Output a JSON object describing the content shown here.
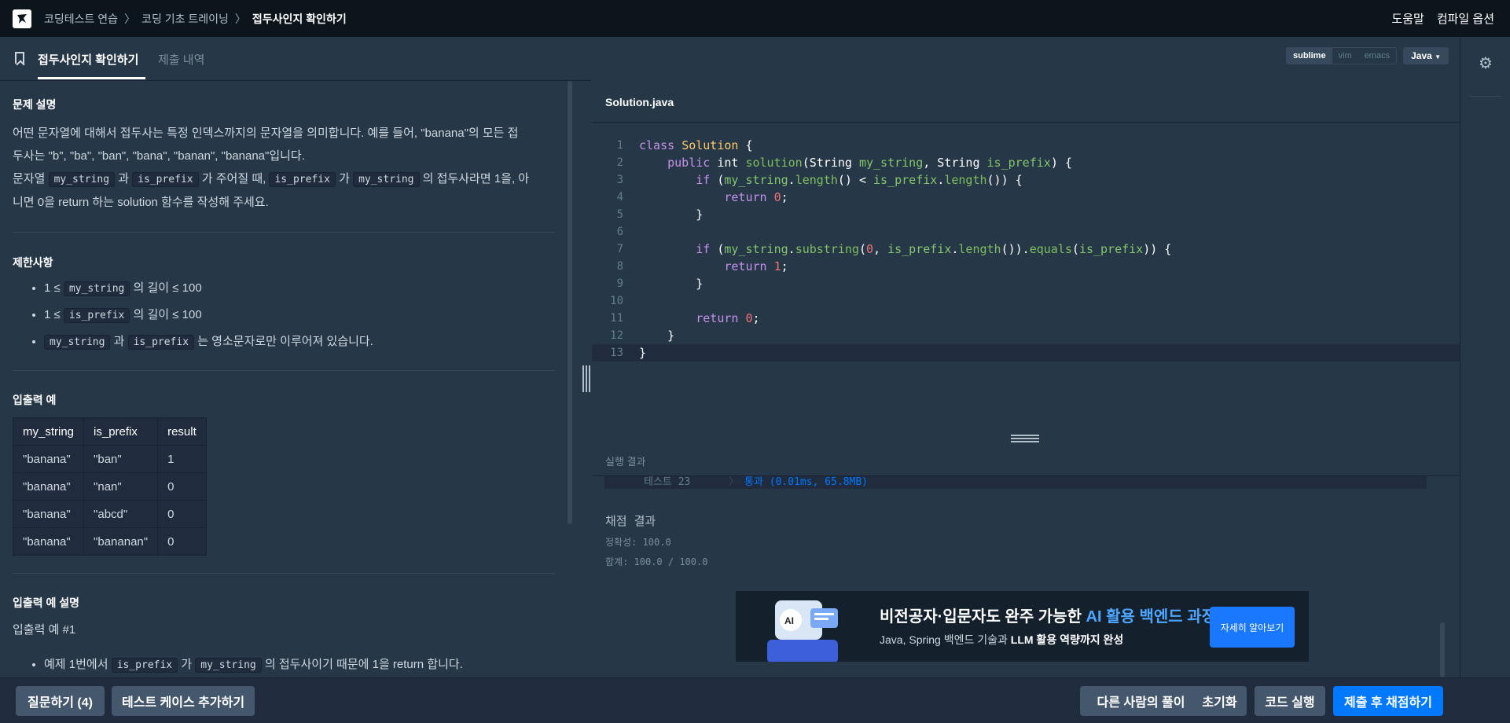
{
  "header": {
    "breadcrumbs": [
      "코딩테스트 연습",
      "코딩 기초 트레이닝",
      "접두사인지 확인하기"
    ],
    "links": [
      "도움말",
      "컴파일 옵션"
    ]
  },
  "tabs": {
    "active": "접두사인지 확인하기",
    "other": "제출 내역"
  },
  "problem": {
    "desc_title": "문제 설명",
    "desc_line1": "어떤 문자열에 대해서 접두사는 특정 인덱스까지의 문자열을 의미합니다. 예를 들어, \"banana\"의 모든 접",
    "desc_line2": "두사는 \"b\", \"ba\", \"ban\", \"bana\", \"banan\", \"banana\"입니다.",
    "desc_line3_a": "문자열 ",
    "desc_line3_code1": "my_string",
    "desc_line3_b": " 과 ",
    "desc_line3_code2": "is_prefix",
    "desc_line3_c": " 가 주어질 때, ",
    "desc_line3_code3": "is_prefix",
    "desc_line3_d": " 가 ",
    "desc_line3_code4": "my_string",
    "desc_line3_e": " 의 접두사라면 1을, 아",
    "desc_line4": "니면 0을 return 하는 solution 함수를 작성해 주세요.",
    "constraints_title": "제한사항",
    "c1_a": "1 ≤ ",
    "c1_code": "my_string",
    "c1_b": " 의 길이 ≤ 100",
    "c2_a": "1 ≤ ",
    "c2_code": "is_prefix",
    "c2_b": " 의 길이 ≤ 100",
    "c3_code1": "my_string",
    "c3_a": " 과 ",
    "c3_code2": "is_prefix",
    "c3_b": " 는 영소문자로만 이루어져 있습니다.",
    "io_title": "입출력 예",
    "io_headers": [
      "my_string",
      "is_prefix",
      "result"
    ],
    "io_rows": [
      [
        "\"banana\"",
        "\"ban\"",
        "1"
      ],
      [
        "\"banana\"",
        "\"nan\"",
        "0"
      ],
      [
        "\"banana\"",
        "\"abcd\"",
        "0"
      ],
      [
        "\"banana\"",
        "\"bananan\"",
        "0"
      ]
    ],
    "io_desc_title": "입출력 예 설명",
    "io_ex1": "입출력 예 #1",
    "ex1_a": "예제 1번에서 ",
    "ex1_code1": "is_prefix",
    "ex1_b": " 가 ",
    "ex1_code2": "my_string",
    "ex1_c": " 의 접두사이기 때문에 1을 return 합니다."
  },
  "editor": {
    "filename": "Solution.java",
    "keymaps": [
      "sublime",
      "vim",
      "emacs"
    ],
    "language": "Java",
    "line_numbers": [
      "1",
      "2",
      "3",
      "4",
      "5",
      "6",
      "7",
      "8",
      "9",
      "10",
      "11",
      "12",
      "13"
    ]
  },
  "result": {
    "title": "실행 결과",
    "test_label": "테스트 23",
    "test_sep": "〉",
    "test_result": "통과 (0.01ms, 65.8MB)",
    "grade_title": "채점 결과",
    "accuracy": "정확성: 100.0",
    "total": "합계: 100.0 / 100.0"
  },
  "banner": {
    "line1_a": "비전공자·입문자도 완주 가능한 ",
    "line1_b": "AI 활용 백엔드 과정",
    "line2_a": "Java, Spring 백엔드 기술과 ",
    "line2_b": "LLM 활용 역량까지 완성",
    "button": "자세히 알아보기"
  },
  "bottom": {
    "ask": "질문하기 (4)",
    "add_test": "테스트 케이스 추가하기",
    "others": "다른 사람의 풀이",
    "reset": "초기화",
    "run": "코드 실행",
    "submit": "제출 후 채점하기"
  },
  "colors": {
    "accent": "#0078ff",
    "bg": "#263747",
    "topbar": "#0c151c"
  }
}
